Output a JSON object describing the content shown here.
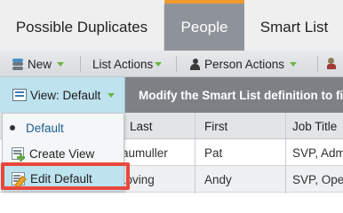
{
  "tabs": [
    {
      "label": "Possible Duplicates",
      "active": false
    },
    {
      "label": "People",
      "active": true
    },
    {
      "label": "Smart List",
      "active": false
    }
  ],
  "toolbar": {
    "new_label": "New",
    "list_actions_label": "List Actions",
    "person_actions_label": "Person Actions"
  },
  "view": {
    "button_label": "View: Default",
    "smartlist_message": "Modify the Smart List definition to find"
  },
  "table": {
    "columns": [
      "Last",
      "First",
      "Job Title"
    ],
    "rows": [
      {
        "last": "Baumuller",
        "first": "Pat",
        "job_title": "SVP, Admin"
      },
      {
        "last": "Loving",
        "first": "Andy",
        "job_title": "SVP, Oper"
      }
    ]
  },
  "view_menu": {
    "items": [
      {
        "label": "Default",
        "icon": "bullet-icon"
      },
      {
        "label": "Create View",
        "icon": "create-view-icon"
      },
      {
        "label": "Edit Default",
        "icon": "edit-default-icon",
        "highlighted": true
      }
    ]
  },
  "colors": {
    "active_tab_bg": "#8d9399",
    "active_tab_accent": "#f09a2f",
    "view_bar_bg": "#7d8186",
    "view_button_bg": "#bfe3ee",
    "highlight_border": "#e9473c",
    "caret_green": "#6bb547"
  }
}
